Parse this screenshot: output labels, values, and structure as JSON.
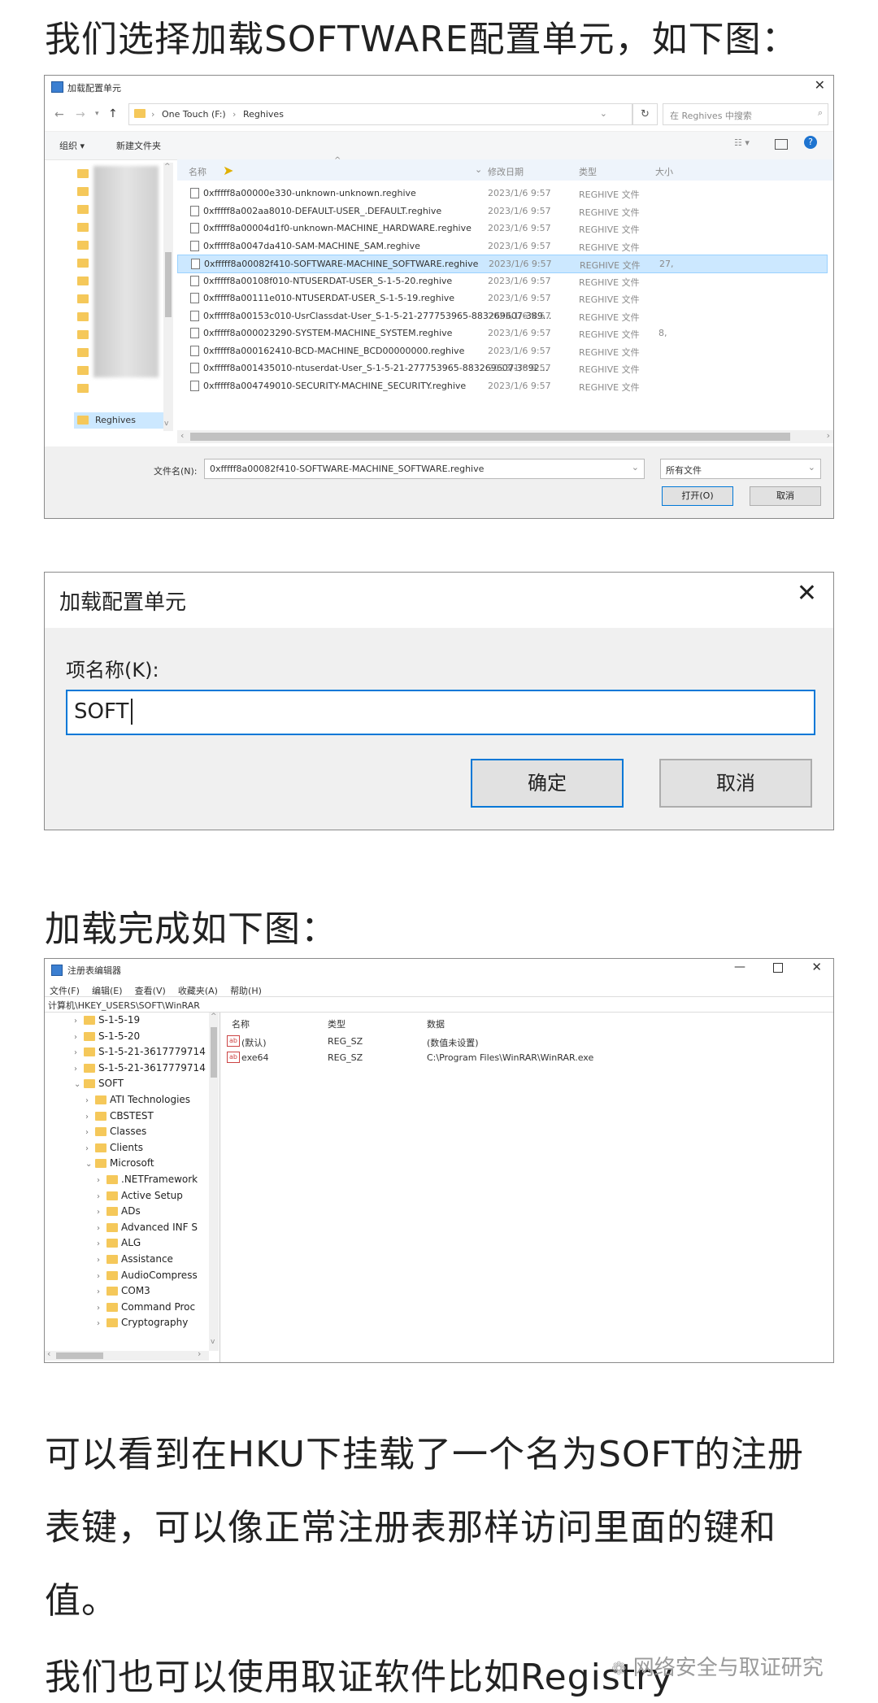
{
  "heading1": "我们选择加载SOFTWARE配置单元，如下图：",
  "file_dialog": {
    "title": "加载配置单元",
    "path": [
      "One Touch (F:)",
      "Reghives"
    ],
    "search_placeholder": "在 Reghives 中搜索",
    "organize": "组织 ▾",
    "new_folder": "新建文件夹",
    "columns": {
      "name": "名称",
      "modified": "修改日期",
      "type": "类型",
      "size": "大小"
    },
    "sidebar_selected": "Reghives",
    "files": [
      {
        "name": "0xfffff8a00000e330-unknown-unknown.reghive",
        "date": "2023/1/6 9:57",
        "type": "REGHIVE 文件",
        "size": ""
      },
      {
        "name": "0xfffff8a002aa8010-DEFAULT-USER_.DEFAULT.reghive",
        "date": "2023/1/6 9:57",
        "type": "REGHIVE 文件",
        "size": ""
      },
      {
        "name": "0xfffff8a00004d1f0-unknown-MACHINE_HARDWARE.reghive",
        "date": "2023/1/6 9:57",
        "type": "REGHIVE 文件",
        "size": ""
      },
      {
        "name": "0xfffff8a0047da410-SAM-MACHINE_SAM.reghive",
        "date": "2023/1/6 9:57",
        "type": "REGHIVE 文件",
        "size": ""
      },
      {
        "name": "0xfffff8a00082f410-SOFTWARE-MACHINE_SOFTWARE.reghive",
        "date": "2023/1/6 9:57",
        "type": "REGHIVE 文件",
        "size": "27,"
      },
      {
        "name": "0xfffff8a00108f010-NTUSERDAT-USER_S-1-5-20.reghive",
        "date": "2023/1/6 9:57",
        "type": "REGHIVE 文件",
        "size": ""
      },
      {
        "name": "0xfffff8a00111e010-NTUSERDAT-USER_S-1-5-19.reghive",
        "date": "2023/1/6 9:57",
        "type": "REGHIVE 文件",
        "size": ""
      },
      {
        "name": "0xfffff8a00153c010-UsrClassdat-User_S-1-5-21-277753965-883269607-389...",
        "date": "2023/1/6 9:57",
        "type": "REGHIVE 文件",
        "size": ""
      },
      {
        "name": "0xfffff8a000023290-SYSTEM-MACHINE_SYSTEM.reghive",
        "date": "2023/1/6 9:57",
        "type": "REGHIVE 文件",
        "size": "8,"
      },
      {
        "name": "0xfffff8a000162410-BCD-MACHINE_BCD00000000.reghive",
        "date": "2023/1/6 9:57",
        "type": "REGHIVE 文件",
        "size": ""
      },
      {
        "name": "0xfffff8a001435010-ntuserdat-User_S-1-5-21-277753965-883269607-3892...",
        "date": "2023/1/6 9:57",
        "type": "REGHIVE 文件",
        "size": ""
      },
      {
        "name": "0xfffff8a004749010-SECURITY-MACHINE_SECURITY.reghive",
        "date": "2023/1/6 9:57",
        "type": "REGHIVE 文件",
        "size": ""
      }
    ],
    "filename_label": "文件名(N):",
    "filename_value": "0xfffff8a00082f410-SOFTWARE-MACHINE_SOFTWARE.reghive",
    "filter_value": "所有文件",
    "open_button": "打开(O)",
    "cancel_button": "取消"
  },
  "load_dialog": {
    "title": "加载配置单元",
    "label": "项名称(K):",
    "value": "SOFT",
    "ok_button": "确定",
    "cancel_button": "取消"
  },
  "heading2": "加载完成如下图：",
  "regedit": {
    "title": "注册表编辑器",
    "menu": [
      "文件(F)",
      "编辑(E)",
      "查看(V)",
      "收藏夹(A)",
      "帮助(H)"
    ],
    "address": "计算机\\HKEY_USERS\\SOFT\\WinRAR",
    "tree": [
      {
        "label": "S-1-5-19",
        "indent": 0
      },
      {
        "label": "S-1-5-20",
        "indent": 0
      },
      {
        "label": "S-1-5-21-3617779714",
        "indent": 0
      },
      {
        "label": "S-1-5-21-3617779714",
        "indent": 0
      },
      {
        "label": "SOFT",
        "indent": 0
      },
      {
        "label": "ATI Technologies",
        "indent": 1
      },
      {
        "label": "CBSTEST",
        "indent": 1
      },
      {
        "label": "Classes",
        "indent": 1
      },
      {
        "label": "Clients",
        "indent": 1
      },
      {
        "label": "Microsoft",
        "indent": 1
      },
      {
        "label": ".NETFramework",
        "indent": 2
      },
      {
        "label": "Active Setup",
        "indent": 2
      },
      {
        "label": "ADs",
        "indent": 2
      },
      {
        "label": "Advanced INF S",
        "indent": 2
      },
      {
        "label": "ALG",
        "indent": 2
      },
      {
        "label": "Assistance",
        "indent": 2
      },
      {
        "label": "AudioCompress",
        "indent": 2
      },
      {
        "label": "COM3",
        "indent": 2
      },
      {
        "label": "Command Proc",
        "indent": 2
      },
      {
        "label": "Cryptography",
        "indent": 2
      }
    ],
    "columns": {
      "name": "名称",
      "type": "类型",
      "data": "数据"
    },
    "values": [
      {
        "name": "(默认)",
        "type": "REG_SZ",
        "data": "(数值未设置)"
      },
      {
        "name": "exe64",
        "type": "REG_SZ",
        "data": "C:\\Program Files\\WinRAR\\WinRAR.exe"
      }
    ]
  },
  "para1_line1": "可以看到在HKU下挂载了一个名为SOFT的注册",
  "para1_line2": "表键，可以像正常注册表那样访问里面的键和",
  "para1_line3": "值。",
  "para2_line1": "我们也可以使用取证软件比如Registry",
  "watermark": "网络安全与取证研究"
}
